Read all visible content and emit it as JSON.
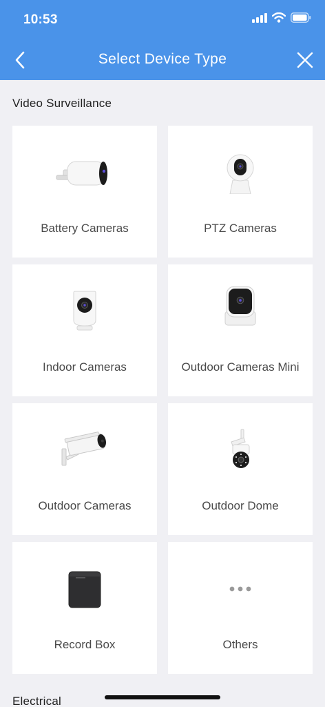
{
  "status_bar": {
    "time": "10:53"
  },
  "nav": {
    "title": "Select Device Type"
  },
  "sections": [
    {
      "title": "Video Surveillance"
    },
    {
      "title": "Electrical"
    }
  ],
  "devices": [
    {
      "label": "Battery Cameras",
      "icon": "battery-camera-icon"
    },
    {
      "label": "PTZ Cameras",
      "icon": "ptz-camera-icon"
    },
    {
      "label": "Indoor Cameras",
      "icon": "indoor-camera-icon"
    },
    {
      "label": "Outdoor Cameras Mini",
      "icon": "outdoor-camera-mini-icon"
    },
    {
      "label": "Outdoor Cameras",
      "icon": "outdoor-camera-icon"
    },
    {
      "label": "Outdoor Dome",
      "icon": "outdoor-dome-icon"
    },
    {
      "label": "Record Box",
      "icon": "record-box-icon"
    },
    {
      "label": "Others",
      "icon": "more-icon"
    }
  ],
  "colors": {
    "header": "#4a93e9",
    "background": "#f0f0f4",
    "card": "#ffffff"
  }
}
